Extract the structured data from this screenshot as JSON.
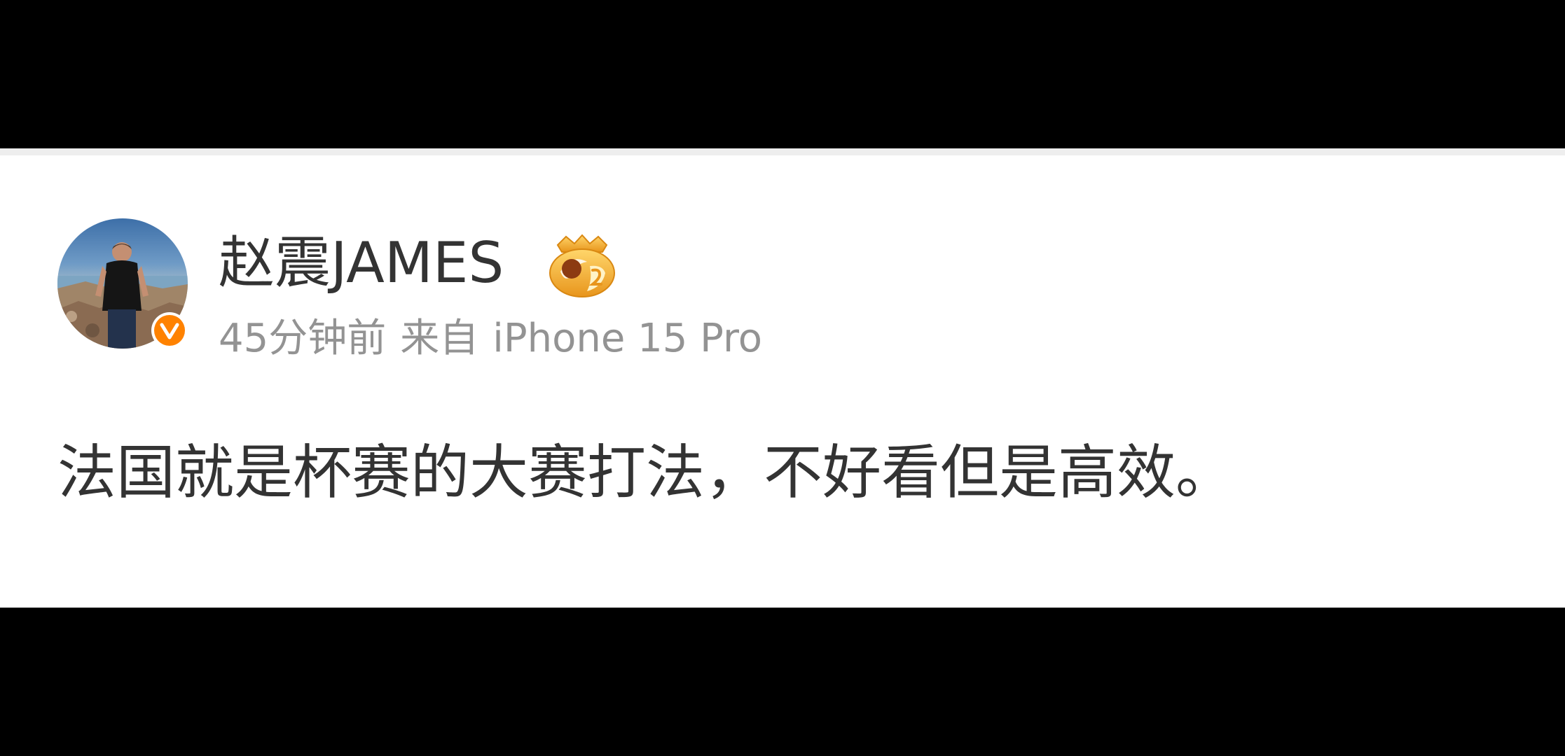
{
  "post": {
    "author": {
      "name": "赵震JAMES",
      "verified_icon": "verified-v-badge-icon",
      "level_icon": "gold-crown-2-icon"
    },
    "time_ago": "45分钟前",
    "source_prefix": "来自",
    "source_device": "iPhone 15 Pro",
    "text": "法国就是杯赛的大赛打法，不好看但是高效。"
  },
  "colors": {
    "background": "#000000",
    "card": "#ffffff",
    "text_primary": "#333333",
    "text_meta": "#939393",
    "verified_badge": "#ff8200"
  }
}
